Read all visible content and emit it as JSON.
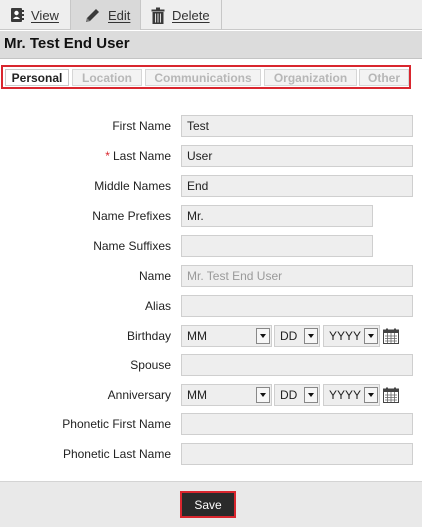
{
  "toolbar": {
    "view_label": "View",
    "edit_label": "Edit",
    "delete_label": "Delete",
    "view_icon": "contact-card-icon",
    "edit_icon": "pencil-icon",
    "delete_icon": "trash-icon"
  },
  "header": {
    "title": "Mr. Test End User"
  },
  "tabs": [
    {
      "label": "Personal",
      "active": true
    },
    {
      "label": "Location",
      "active": false
    },
    {
      "label": "Communications",
      "active": false
    },
    {
      "label": "Organization",
      "active": false
    },
    {
      "label": "Other",
      "active": false
    }
  ],
  "form": {
    "first_name": {
      "label": "First Name",
      "value": "Test"
    },
    "last_name": {
      "label": "Last Name",
      "value": "User",
      "required_marker": "*"
    },
    "middle_names": {
      "label": "Middle Names",
      "value": "End"
    },
    "name_prefixes": {
      "label": "Name Prefixes",
      "value": "Mr."
    },
    "name_suffixes": {
      "label": "Name Suffixes",
      "value": ""
    },
    "name": {
      "label": "Name",
      "value": "Mr. Test End User"
    },
    "alias": {
      "label": "Alias",
      "value": ""
    },
    "birthday": {
      "label": "Birthday",
      "month": "MM",
      "day": "DD",
      "year": "YYYY"
    },
    "spouse": {
      "label": "Spouse",
      "value": ""
    },
    "anniversary": {
      "label": "Anniversary",
      "month": "MM",
      "day": "DD",
      "year": "YYYY"
    },
    "phonetic_first_name": {
      "label": "Phonetic First Name",
      "value": ""
    },
    "phonetic_last_name": {
      "label": "Phonetic Last Name",
      "value": ""
    }
  },
  "footer": {
    "save_label": "Save"
  },
  "colors": {
    "highlight": "#d9262e",
    "button_bg": "#2a2a2a",
    "required": "#d9262e"
  }
}
